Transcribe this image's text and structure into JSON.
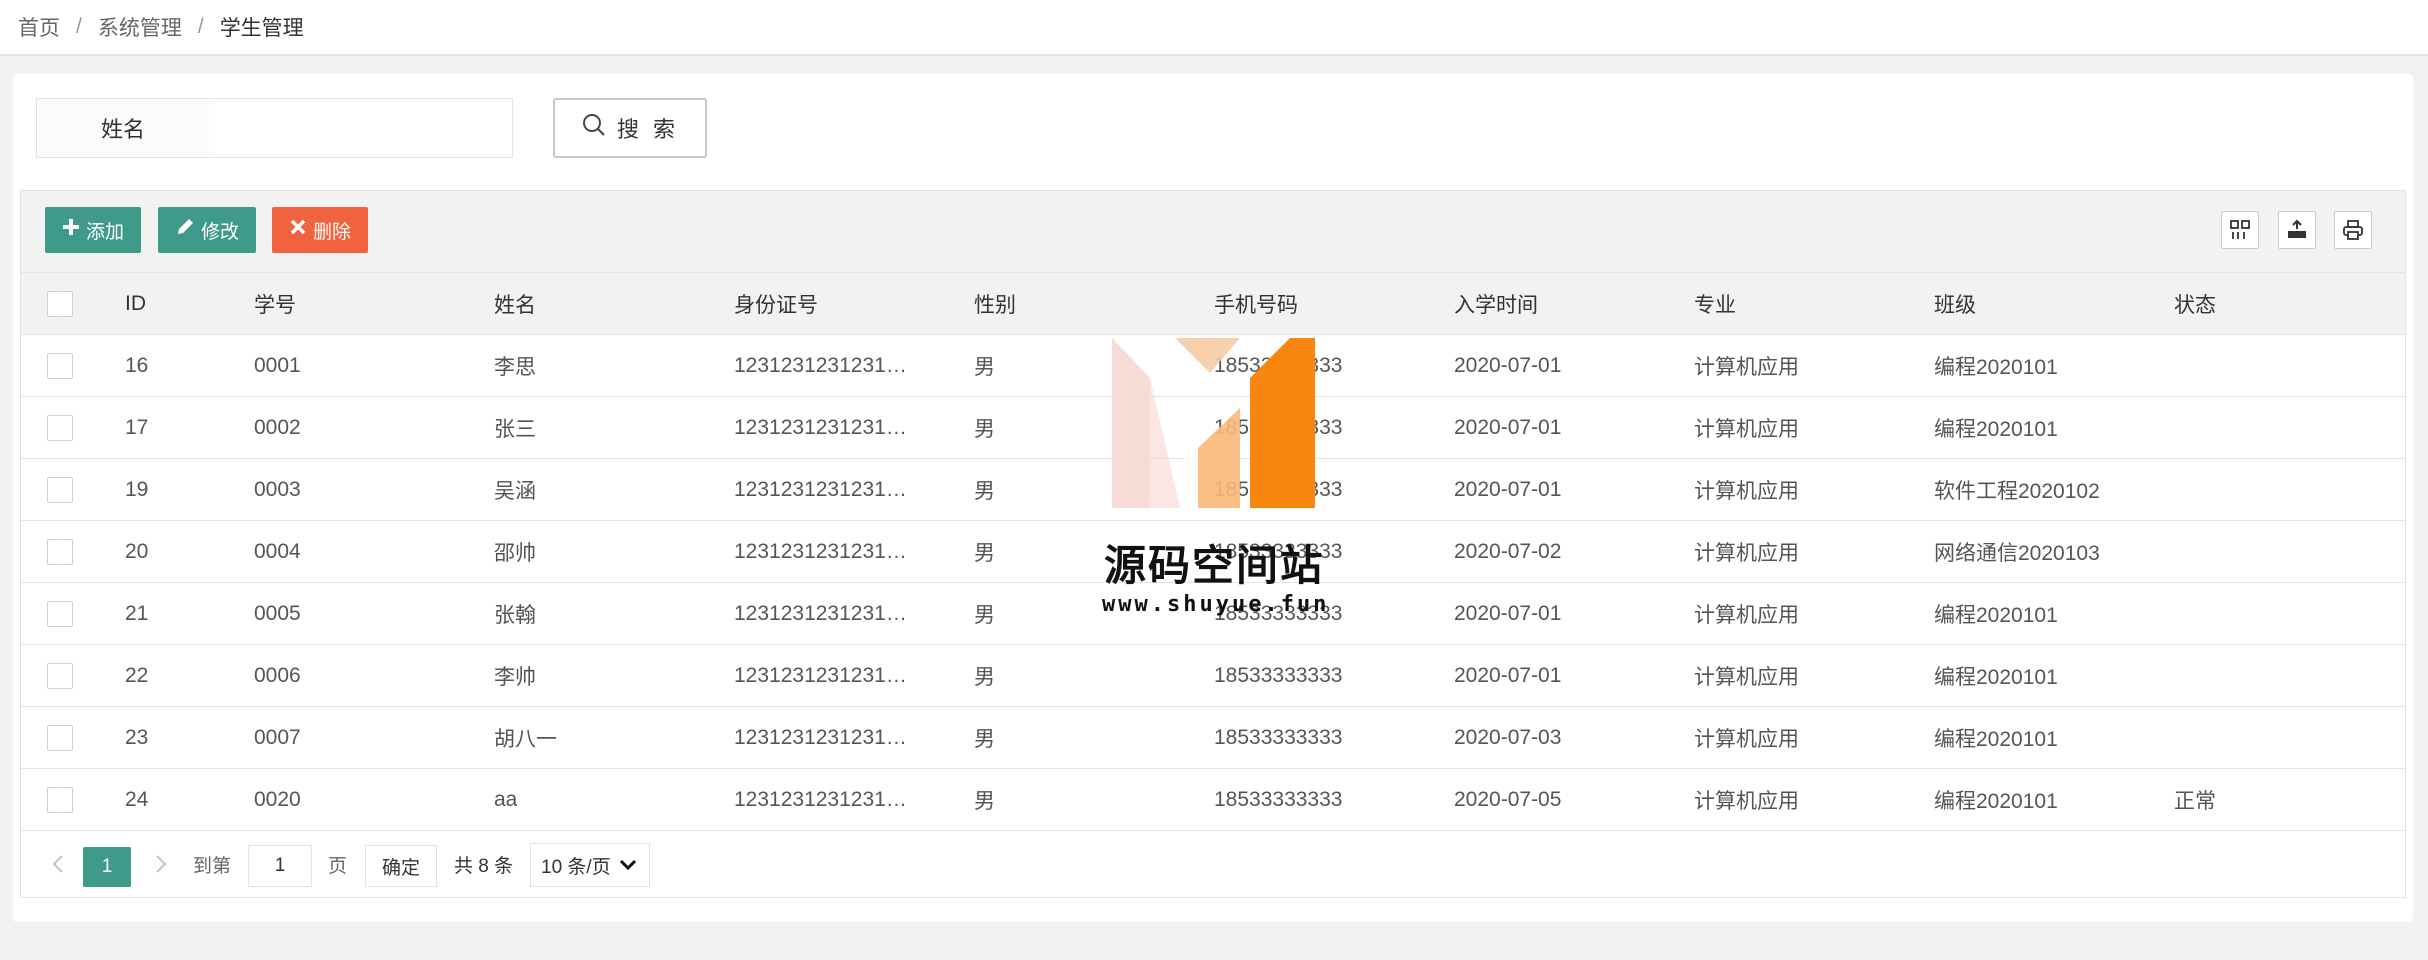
{
  "breadcrumb": {
    "items": [
      "首页",
      "系统管理",
      "学生管理"
    ],
    "separator": "/"
  },
  "search": {
    "label": "姓名",
    "value": "",
    "placeholder": "",
    "button_label": "搜 索"
  },
  "toolbar": {
    "add_label": "添加",
    "edit_label": "修改",
    "delete_label": "删除",
    "right_icons": [
      "columns-icon",
      "export-icon",
      "print-icon"
    ]
  },
  "table": {
    "columns": [
      "ID",
      "学号",
      "姓名",
      "身份证号",
      "性别",
      "手机号码",
      "入学时间",
      "专业",
      "班级",
      "状态"
    ],
    "rows": [
      [
        "16",
        "0001",
        "李思",
        "1231231231231…",
        "男",
        "18533333333",
        "2020-07-01",
        "计算机应用",
        "编程2020101",
        ""
      ],
      [
        "17",
        "0002",
        "张三",
        "1231231231231…",
        "男",
        "18533333333",
        "2020-07-01",
        "计算机应用",
        "编程2020101",
        ""
      ],
      [
        "19",
        "0003",
        "吴涵",
        "1231231231231…",
        "男",
        "18533333333",
        "2020-07-01",
        "计算机应用",
        "软件工程2020102",
        ""
      ],
      [
        "20",
        "0004",
        "邵帅",
        "1231231231231…",
        "男",
        "18533333333",
        "2020-07-02",
        "计算机应用",
        "网络通信2020103",
        ""
      ],
      [
        "21",
        "0005",
        "张翰",
        "1231231231231…",
        "男",
        "18533333333",
        "2020-07-01",
        "计算机应用",
        "编程2020101",
        ""
      ],
      [
        "22",
        "0006",
        "李帅",
        "1231231231231…",
        "男",
        "18533333333",
        "2020-07-01",
        "计算机应用",
        "编程2020101",
        ""
      ],
      [
        "23",
        "0007",
        "胡八一",
        "1231231231231…",
        "男",
        "18533333333",
        "2020-07-03",
        "计算机应用",
        "编程2020101",
        ""
      ],
      [
        "24",
        "0020",
        "aa",
        "1231231231231…",
        "男",
        "18533333333",
        "2020-07-05",
        "计算机应用",
        "编程2020101",
        "正常"
      ]
    ]
  },
  "pagination": {
    "current_page": "1",
    "goto_label": "到第",
    "goto_value": "1",
    "page_unit": "页",
    "confirm_label": "确定",
    "total_label": "共 8 条",
    "page_size": "10 条/页"
  },
  "watermark": {
    "title": "源码空间站",
    "url": "www.shuyue.fun"
  },
  "colors": {
    "primary": "#3f9a8c",
    "danger": "#f0633e",
    "watermark_orange": "#f5870f"
  }
}
